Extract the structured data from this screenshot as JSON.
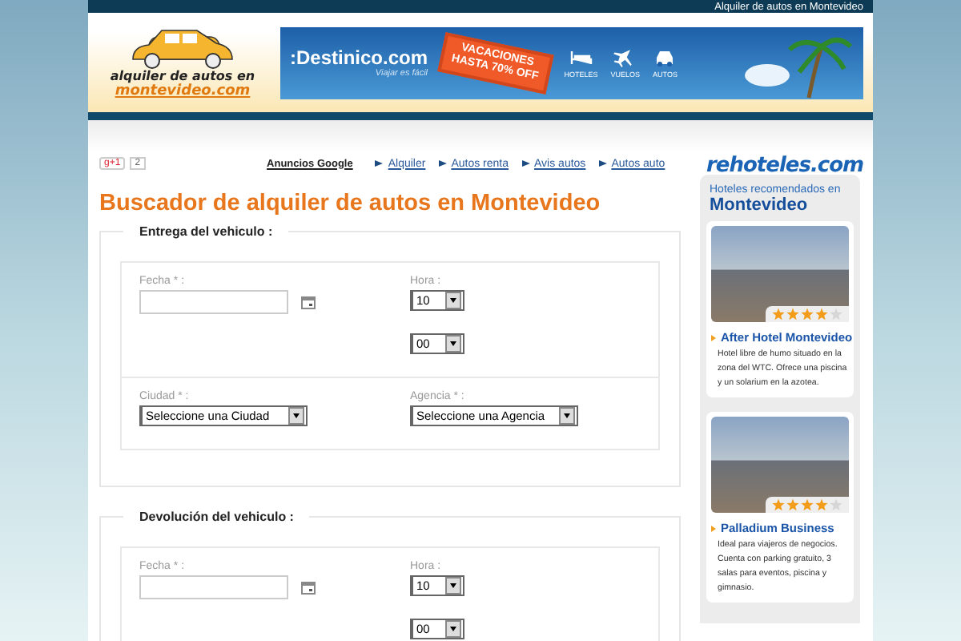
{
  "top_bar": {
    "text": "Alquiler de autos en Montevideo"
  },
  "logo": {
    "line1": "alquiler de autos en",
    "line2": "montevideo.com"
  },
  "banner": {
    "brand": ":Destinico.com",
    "slogan": "Viajar es fácil",
    "promo_title": "VACACIONES",
    "promo_sub": "HASTA 70% OFF",
    "links": [
      {
        "kind": "hotel",
        "label": "HOTELES"
      },
      {
        "kind": "flight",
        "label": "VUELOS"
      },
      {
        "kind": "car",
        "label": "AUTOS"
      }
    ]
  },
  "social": {
    "button": "g+1",
    "count": "2"
  },
  "ads": {
    "label": "Anuncios Google",
    "links": [
      "Alquiler",
      "Autos renta",
      "Avis autos",
      "Autos auto"
    ]
  },
  "title": "Buscador de alquiler de autos en Montevideo",
  "sections": [
    {
      "legend": "Entrega del vehiculo :",
      "rows": [
        {
          "cells": [
            {
              "label": "Fecha * :",
              "controls": [
                {
                  "kind": "date"
                }
              ]
            },
            {
              "label": "Hora :",
              "controls": [
                {
                  "kind": "select",
                  "value": "10"
                },
                {
                  "kind": "select",
                  "value": "00"
                }
              ]
            }
          ]
        },
        {
          "cells": [
            {
              "label": "Ciudad * :",
              "controls": [
                {
                  "kind": "select",
                  "value": "Seleccione una Ciudad"
                }
              ]
            },
            {
              "label": "Agencia * :",
              "controls": [
                {
                  "kind": "select",
                  "value": "Seleccione una Agencia"
                }
              ]
            }
          ]
        }
      ]
    },
    {
      "legend": "Devolución del vehiculo :",
      "rows": [
        {
          "cells": [
            {
              "label": "Fecha * :",
              "controls": [
                {
                  "kind": "date"
                }
              ]
            },
            {
              "label": "Hora :",
              "controls": [
                {
                  "kind": "select",
                  "value": "10"
                },
                {
                  "kind": "select",
                  "value": "00"
                }
              ]
            }
          ]
        }
      ]
    }
  ],
  "sidebar": {
    "logo": "rehoteles.com",
    "heading": "Hoteles recomendados en",
    "city": "Montevideo",
    "hotels": [
      {
        "name": "After Hotel Montevideo",
        "stars": 4,
        "description": "Hotel libre de humo situado en la zona del WTC. Ofrece una piscina y un solarium en la azotea."
      },
      {
        "name": "Palladium Business",
        "stars": 4,
        "description": "Ideal para viajeros de negocios. Cuenta con parking gratuito, 3 salas para eventos, piscina y gimnasio."
      }
    ]
  }
}
